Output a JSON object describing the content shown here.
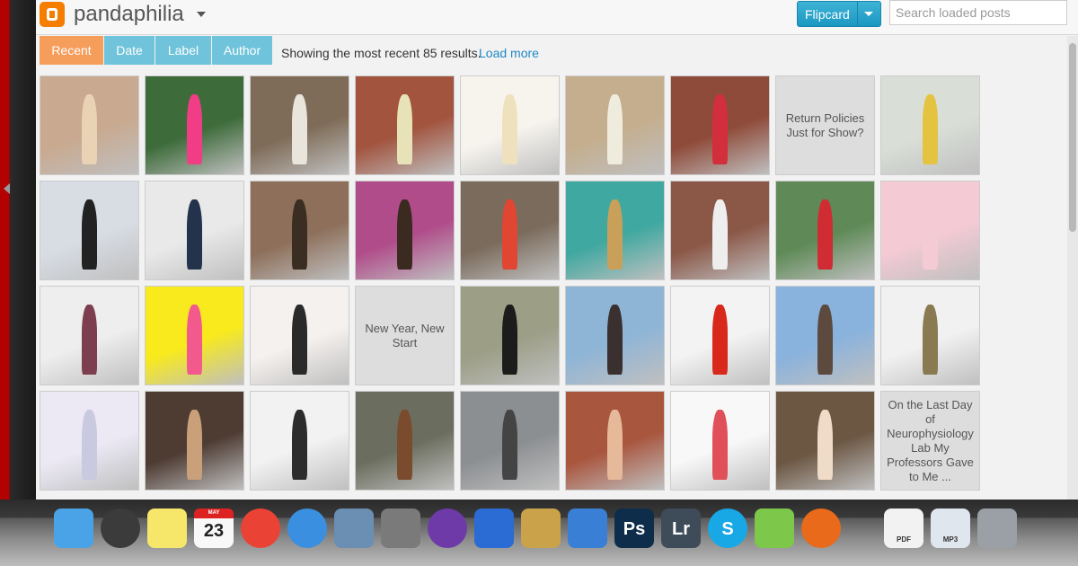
{
  "blog": {
    "title": "pandaphilia"
  },
  "toolbar": {
    "flipcard_label": "Flipcard",
    "search_placeholder": "Search loaded posts"
  },
  "tabs": [
    {
      "label": "Recent",
      "active": true
    },
    {
      "label": "Date",
      "active": false
    },
    {
      "label": "Label",
      "active": false
    },
    {
      "label": "Author",
      "active": false
    }
  ],
  "status": {
    "text": "Showing the most recent 85 results.",
    "load_more": "Load more"
  },
  "tiles": [
    {
      "type": "photo",
      "bg": "#c9a98f",
      "fg": "#e9d3b4"
    },
    {
      "type": "photo",
      "bg": "#3d6b3a",
      "fg": "#f03d86"
    },
    {
      "type": "photo",
      "bg": "#7f6c58",
      "fg": "#e9e4dc"
    },
    {
      "type": "photo",
      "bg": "#a2543f",
      "fg": "#e8e2b8"
    },
    {
      "type": "photo",
      "bg": "#f7f4ee",
      "fg": "#efe1bd"
    },
    {
      "type": "photo",
      "bg": "#c4ae8e",
      "fg": "#f0ecdd"
    },
    {
      "type": "photo",
      "bg": "#8f4b3a",
      "fg": "#d32e3c"
    },
    {
      "type": "text",
      "caption": "Return Policies Just for Show?"
    },
    {
      "type": "photo",
      "bg": "#d9dfd7",
      "fg": "#e3c340"
    },
    {
      "type": "photo",
      "bg": "#d8dde4",
      "fg": "#222222"
    },
    {
      "type": "photo",
      "bg": "#e9e9e9",
      "fg": "#24334c"
    },
    {
      "type": "photo",
      "bg": "#8d6f5a",
      "fg": "#3a2d22"
    },
    {
      "type": "photo",
      "bg": "#b04c8a",
      "fg": "#3a2a20"
    },
    {
      "type": "photo",
      "bg": "#7b6b5c",
      "fg": "#e04632"
    },
    {
      "type": "photo",
      "bg": "#3fa8a0",
      "fg": "#c8a05a"
    },
    {
      "type": "photo",
      "bg": "#8b5848",
      "fg": "#eeeeee"
    },
    {
      "type": "photo",
      "bg": "#5f8a57",
      "fg": "#d02c34"
    },
    {
      "type": "photo",
      "bg": "#f4cad5",
      "fg": "#f4cad5"
    },
    {
      "type": "photo",
      "bg": "#eeeeee",
      "fg": "#7d3f50"
    },
    {
      "type": "photo",
      "bg": "#f8ea1c",
      "fg": "#f25a8e"
    },
    {
      "type": "photo",
      "bg": "#f5f1ee",
      "fg": "#2a2a2a"
    },
    {
      "type": "text",
      "caption": "New Year, New Start"
    },
    {
      "type": "photo",
      "bg": "#9c9e86",
      "fg": "#1c1c1c"
    },
    {
      "type": "photo",
      "bg": "#8fb5d6",
      "fg": "#3b3030"
    },
    {
      "type": "photo",
      "bg": "#f3f3f3",
      "fg": "#d8281c"
    },
    {
      "type": "photo",
      "bg": "#89b2dd",
      "fg": "#5d4a3f"
    },
    {
      "type": "photo",
      "bg": "#f1f1f1",
      "fg": "#8a7a52"
    },
    {
      "type": "photo",
      "bg": "#ece9f5",
      "fg": "#c9c9e0"
    },
    {
      "type": "photo",
      "bg": "#4e3c33",
      "fg": "#c9a07a"
    },
    {
      "type": "photo",
      "bg": "#f2f2f2",
      "fg": "#2c2c2c"
    },
    {
      "type": "photo",
      "bg": "#6b6e5e",
      "fg": "#7a4b2d"
    },
    {
      "type": "photo",
      "bg": "#8c8f92",
      "fg": "#444444"
    },
    {
      "type": "photo",
      "bg": "#a9563e",
      "fg": "#e6b99a"
    },
    {
      "type": "photo",
      "bg": "#f8f8f8",
      "fg": "#e05058"
    },
    {
      "type": "photo",
      "bg": "#6c5743",
      "fg": "#f0dac8"
    },
    {
      "type": "text",
      "caption": "On the Last Day of Neurophysiology Lab My Professors Gave to Me ..."
    }
  ],
  "dock": {
    "items": [
      {
        "name": "finder-icon",
        "color": "#4aa3e6"
      },
      {
        "name": "dashboard-icon",
        "color": "#3b3b3b"
      },
      {
        "name": "stickies-icon",
        "color": "#f6e66a"
      },
      {
        "name": "calendar-icon",
        "color": "#f8f8f8",
        "month": "MAY",
        "day": "23"
      },
      {
        "name": "chrome-icon",
        "color": "#ea4335"
      },
      {
        "name": "itunes-icon",
        "color": "#3b8fe0"
      },
      {
        "name": "preview-icon",
        "color": "#6a8fb3"
      },
      {
        "name": "system-preferences-icon",
        "color": "#7a7a7a"
      },
      {
        "name": "venus-app-icon",
        "color": "#6d3aa8"
      },
      {
        "name": "word-icon",
        "color": "#2b6bd4"
      },
      {
        "name": "photo-camera-icon",
        "color": "#c9a24a"
      },
      {
        "name": "image-capture-icon",
        "color": "#3a7fd6"
      },
      {
        "name": "photoshop-icon",
        "color": "#0d2d4b",
        "text": "Ps"
      },
      {
        "name": "lightroom-icon",
        "color": "#3e4b58",
        "text": "Lr"
      },
      {
        "name": "skype-icon",
        "color": "#18a8e6",
        "text": "S"
      },
      {
        "name": "network-icon",
        "color": "#7dc84a"
      },
      {
        "name": "firefox-icon",
        "color": "#e86a1a"
      },
      {
        "name": "pdf-document-icon",
        "color": "#f2f2f2",
        "text": "PDF"
      },
      {
        "name": "mp3-document-icon",
        "color": "#e0e6ee",
        "text": "MP3"
      },
      {
        "name": "trash-icon",
        "color": "#9aa0a6"
      }
    ]
  }
}
